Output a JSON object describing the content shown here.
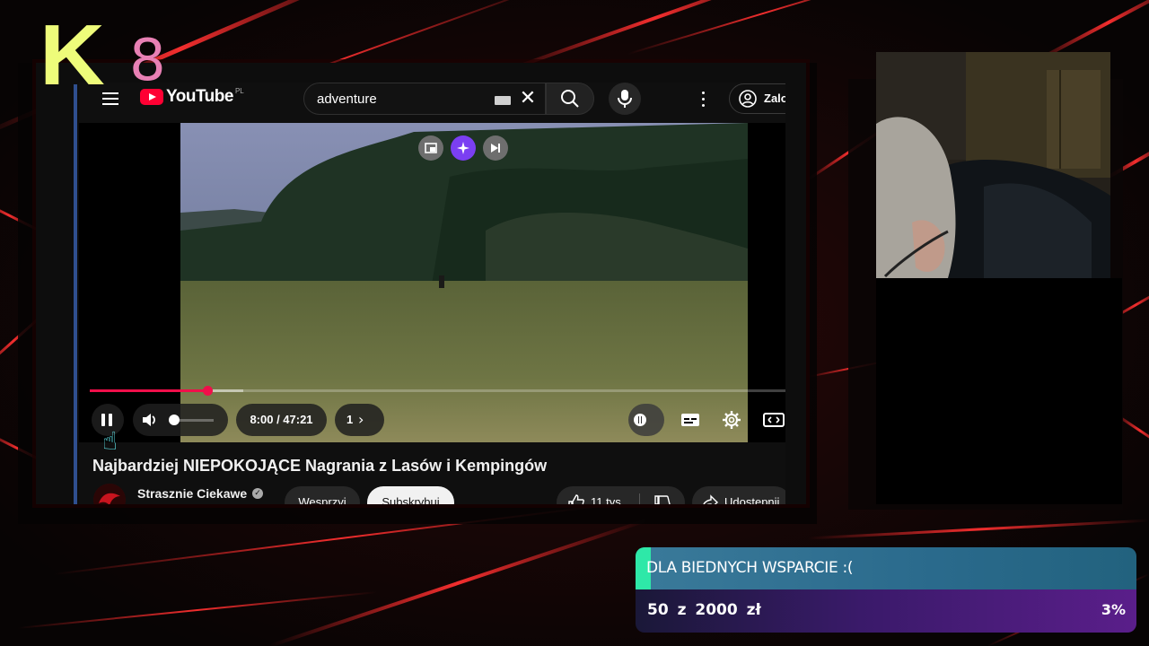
{
  "overlay": {
    "logo_letter": "K",
    "logo_number": "8"
  },
  "youtube": {
    "logo_text": "YouTube",
    "logo_country": "PL",
    "search": {
      "value": "adventure",
      "placeholder": ""
    },
    "sign_in_label": "Zalo",
    "player": {
      "time_display": "8:00 / 47:21",
      "chapter_label": "1",
      "progress_percent": 16.9,
      "loaded_percent": 22,
      "volume_percent": 0
    },
    "video": {
      "title": "Najbardziej NIEPOKOJĄCE Nagrania z Lasów i Kempingów",
      "channel": "Strasznie Ciekawe",
      "join_label": "Wesprzyj",
      "subscribe_label": "Subskrybuj",
      "likes": "11 tys.",
      "share_label": "Udostępnij"
    }
  },
  "donation_goal": {
    "title": "DLA BIEDNYCH WSPARCIE :(",
    "amount_text": "50 z 2000 zł",
    "percent_text": "3%",
    "progress_percent": 3,
    "accent_color": "#2ee8a8"
  },
  "colors": {
    "youtube_red": "#ff0033",
    "progress_red": "#f00f4a",
    "logo_yellow": "#eefc7a",
    "logo_pink": "#e880b4"
  }
}
